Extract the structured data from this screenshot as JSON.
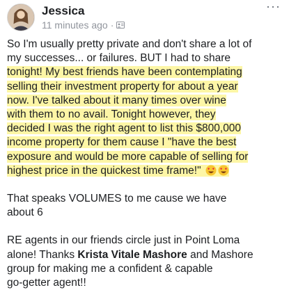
{
  "post": {
    "author": "Jessica",
    "time": "11 minutes ago",
    "separator": "·",
    "more_label": "···",
    "lines_a": [
      "So I'm usually pretty private and don't share a lot of",
      "my successes... or failures.  BUT I had to share"
    ],
    "lines_hl": [
      "tonight!  My best friends have been contemplating",
      "selling their investment property for about a year",
      "now.  I've talked about it many times over wine",
      "with them to no avail.  Tonight however, they",
      "decided I was the right agent to list this $800,000",
      "income property for them cause I \"have the best",
      "exposure and would be more capable of selling for",
      "highest price in the quickest time frame!\""
    ],
    "para2": [
      "That speaks VOLUMES to me cause we have",
      "about 6"
    ],
    "para3_line1": "RE agents in our friends circle just in Point Loma",
    "para3_line2_pre": "alone!  Thanks ",
    "para3_name": "Krista Vitale Mashore",
    "para3_line2_post": " and Mashore",
    "para3_line3": "group for making me a confident & capable",
    "para3_line4": "go-getter agent!!",
    "icons": {
      "audience": "friends-icon",
      "reaction": "heart-eyes-emoji"
    },
    "colors": {
      "highlight": "#fdf6a6",
      "meta": "#90949c"
    }
  }
}
